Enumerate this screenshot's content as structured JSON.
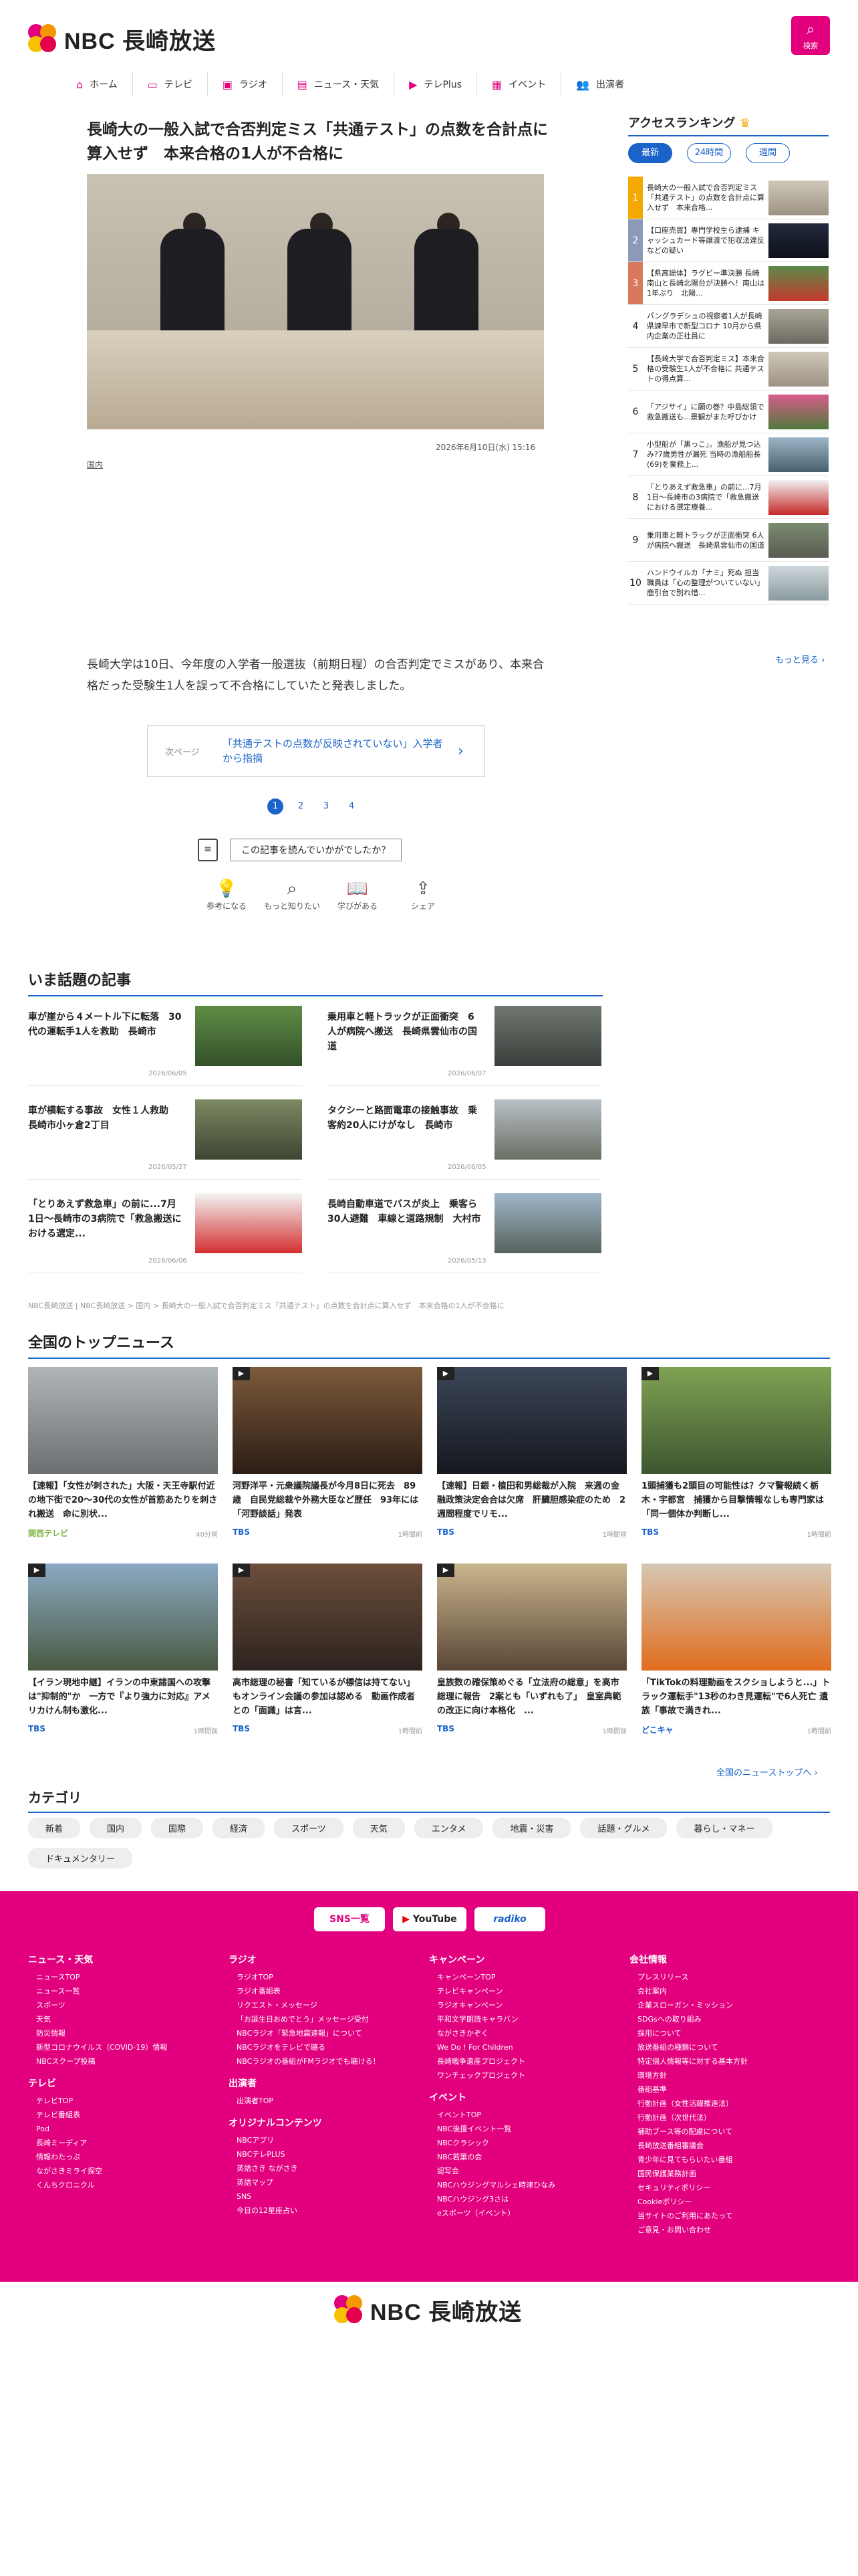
{
  "header": {
    "brand": "NBC 長崎放送",
    "search_label": "検索"
  },
  "nav": [
    {
      "label": "ホーム",
      "icon": "home-icon"
    },
    {
      "label": "テレビ",
      "icon": "tv-icon"
    },
    {
      "label": "ラジオ",
      "icon": "radio-icon"
    },
    {
      "label": "ニュース・天気",
      "icon": "news-icon"
    },
    {
      "label": "テレPlus",
      "icon": "play-icon"
    },
    {
      "label": "イベント",
      "icon": "calendar-icon"
    },
    {
      "label": "出演者",
      "icon": "people-icon"
    }
  ],
  "article": {
    "title": "長崎大の一般入試で合否判定ミス「共通テスト」の点数を合計点に算入せず　本来合格の1人が不合格に",
    "date": "2026年6月10日(水) 15:16",
    "category": "国内",
    "body": "長崎大学は10日、今年度の入学者一般選抜（前期日程）の合否判定でミスがあり、本来合格だった受験生1人を誤って不合格にしていたと発表しました。",
    "next_label": "次ページ",
    "next_text": "「共通テストの点数が反映されていない」入学者から指摘",
    "pages": [
      "1",
      "2",
      "3",
      "4"
    ],
    "rate_q": "この記事を読んでいかがでしたか？",
    "reactions": [
      {
        "label": "参考になる",
        "icon": "bulb-icon"
      },
      {
        "label": "もっと知りたい",
        "icon": "magnifier-icon"
      },
      {
        "label": "学びがある",
        "icon": "book-icon"
      },
      {
        "label": "シェア",
        "icon": "share-icon"
      }
    ]
  },
  "ranking": {
    "title": "アクセスランキング",
    "tabs": [
      "最新",
      "24時間",
      "週間"
    ],
    "more": "もっと見る ›",
    "items": [
      {
        "n": "1",
        "text": "長崎大の一般入試で合否判定ミス「共通テスト」の点数を合計点に算入せず　本来合格..."
      },
      {
        "n": "2",
        "text": "【口座売買】専門学校生ら逮捕 キャッシュカード等譲渡で犯収法違反などの疑い"
      },
      {
        "n": "3",
        "text": "【県高総体】ラグビー準決勝 長崎南山と長崎北陽台が決勝へ！南山は1年ぶり　北陽..."
      },
      {
        "n": "4",
        "text": "パングラデシュの視察者1人が長崎県諫早市で新型コロナ 10月から県内企業の正社員に"
      },
      {
        "n": "5",
        "text": "【長崎大学で合否判定ミス】本来合格の受験生1人が不合格に 共通テストの得点算..."
      },
      {
        "n": "6",
        "text": "「アジサイ」に願の巻？中島総領で救急搬送も...景観がまた呼びかけ"
      },
      {
        "n": "7",
        "text": "小型船が「黒っこ」。漁船が見つ込み?7歳男性が漏死  当時の漁船船長(69)を業務上..."
      },
      {
        "n": "8",
        "text": "「とりあえず救急車」の前に...7月1日〜長崎市の3病院で「救急搬送における選定療養..."
      },
      {
        "n": "9",
        "text": "乗用車と軽トラックが正面衝突 6人が病院へ搬送　長崎県雲仙市の国道"
      },
      {
        "n": "10",
        "text": "ハンドウイルカ「ナミ」死ぬ 担当職員は「心の整理がついていない」鹿引台で別れ惜..."
      }
    ]
  },
  "topics": {
    "title": "いま話題の記事",
    "items": [
      {
        "text": "車が崖から４メートル下に転落　30代の運転手1人を救助　長崎市",
        "date": "2026/06/05"
      },
      {
        "text": "乗用車と軽トラックが正面衝突　6人が病院へ搬送　長崎県雲仙市の国道",
        "date": "2026/06/07"
      },
      {
        "text": "車が横転する事故　女性１人救助　長崎市小ヶ倉2丁目",
        "date": "2026/05/27"
      },
      {
        "text": "タクシーと路面電車の接触事故　乗客約20人にけがなし　長崎市",
        "date": "2026/06/05"
      },
      {
        "text": "「とりあえず救急車」の前に...7月1日〜長崎市の3病院で「救急搬送における選定...",
        "date": "2026/06/06"
      },
      {
        "text": "長崎自動車道でバスが炎上　乗客ら30人避難　車線と道路規制　大村市",
        "date": "2026/05/13"
      }
    ]
  },
  "breadcrumb": "NBC長崎放送 | NBC長崎放送 > 国内 > 長崎大の一般入試で合否判定ミス「共通テスト」の点数を合計点に算入せず　本来合格の1人が不合格に",
  "national": {
    "title": "全国のトップニュース",
    "more": "全国のニューストップへ ›",
    "items": [
      {
        "text": "【速報】「女性が刺された」大阪・天王寺駅付近の地下街で20〜30代の女性が首筋あたりを刺され搬送　命に別状...",
        "src": "関西テレビ",
        "time": "40分前"
      },
      {
        "text": "河野洋平・元衆議院議長が今月8日に死去　89歳　自民党総裁や外務大臣など歴任　93年には「河野談話」発表",
        "src": "TBS",
        "time": "1時間前"
      },
      {
        "text": "【速報】日銀・植田和男総裁が入院　来週の金融政策決定会合は欠席　肝臓胆感染症のため　2週間程度でリモ...",
        "src": "TBS",
        "time": "1時間前"
      },
      {
        "text": "1頭捕獲も2頭目の可能性は？クマ警報続く栃木・宇都宮　捕獲から目撃情報なしも専門家は「同一個体か判断し...",
        "src": "TBS",
        "time": "1時間前"
      },
      {
        "text": "【イラン現地中継】イランの中東諸国への攻撃は\"抑制的\"か　一方で『より強力に対応』アメリカけん制も激化...",
        "src": "TBS",
        "time": "1時間前"
      },
      {
        "text": "高市総理の秘書「知ているが標信は持てない」もオンライン会議の参加は認める　動画作成者との「面識」は言...",
        "src": "TBS",
        "time": "1時間前"
      },
      {
        "text": "皇族数の確保策めぐる「立法府の総意」を高市総理に報告　2案とも「いずれも了」　皇室典範の改正に向け本格化　...",
        "src": "TBS",
        "time": "1時間前"
      },
      {
        "text": "「TikTokの料理動画をスクショしようと...」トラック運転手\"13秒のわき見運転\"で6人死亡 遺族「事故で満きれ...",
        "src": "どこキャ",
        "time": "1時間前"
      }
    ]
  },
  "categories": {
    "title": "カテゴリ",
    "items": [
      "新着",
      "国内",
      "国際",
      "経済",
      "スポーツ",
      "天気",
      "エンタメ",
      "地震・災害",
      "話題・グルメ",
      "暮らし・マネー",
      "ドキュメンタリー"
    ]
  },
  "footer": {
    "sns": [
      "SNS一覧",
      "YouTube",
      "radiko"
    ],
    "cols": [
      [
        {
          "h": "ニュース・天気",
          "items": [
            "ニュースTOP",
            "ニュース一覧",
            "スポーツ",
            "天気",
            "防災情報",
            "新型コロナウイルス（COVID-19）情報",
            "NBCスクープ投稿"
          ]
        },
        {
          "h": "テレビ",
          "items": [
            "テレビTOP",
            "テレビ番組表",
            "Pod",
            "長崎ミーディア",
            "情報わたっぷ",
            "ながさきミライ探空",
            "くんちクロニクル"
          ]
        }
      ],
      [
        {
          "h": "ラジオ",
          "items": [
            "ラジオTOP",
            "ラジオ番組表",
            "リクエスト・メッセージ",
            "「お誕生日おめでとう」メッセージ受付",
            "NBCラジオ「緊急地震速報」について",
            "NBCラジオをテレビで聴る",
            "NBCラジオの番組がFMラジオでも聴ける！"
          ]
        },
        {
          "h": "出演者",
          "items": [
            "出演者TOP"
          ]
        },
        {
          "h": "オリジナルコンテンツ",
          "items": [
            "NBCアプリ",
            "NBCテレPLUS",
            "英語さき ながさき",
            "英語マップ",
            "SNS",
            "今日の12星座占い"
          ]
        }
      ],
      [
        {
          "h": "キャンペーン",
          "items": [
            "キャンペーンTOP",
            "テレビキャンペーン",
            "ラジオキャンペーン",
            "平和文学朗読キャラバン",
            "ながさきかぞく",
            "We Do ! For Children",
            "長崎戦争遺産プロジェクト",
            "ワンチェックプロジェクト"
          ]
        },
        {
          "h": "イベント",
          "items": [
            "イベントTOP",
            "NBC後援イベント一覧",
            "NBCクラシック",
            "NBC若葉の会",
            "認写会",
            "NBCハウジングマルシェ時津ひなみ",
            "NBCハウジング3さは",
            "eスポーツ（イベント）"
          ]
        }
      ],
      [
        {
          "h": "会社情報",
          "items": [
            "プレスリリース",
            "会社案内",
            "企業スローガン・ミッション",
            "SDGsへの取り組み",
            "採用について",
            "放送番組の種類について",
            "特定個人情報等に対する基本方針",
            "環境方針",
            "番組基準",
            "行動計画（女性活躍推進法）",
            "行動計画（次世代法）",
            "補助ブース等の配慮について",
            "長崎放送番組審議会",
            "青少年に見てもらいたい番組",
            "国民保護業務計画",
            "セキュリティポリシー",
            "Cookieポリシー",
            "当サイトのご利用にあたって",
            "ご意見・お問い合わせ"
          ]
        }
      ]
    ]
  },
  "colors": {
    "accent": "#e3007f",
    "link": "#1a63c8"
  }
}
